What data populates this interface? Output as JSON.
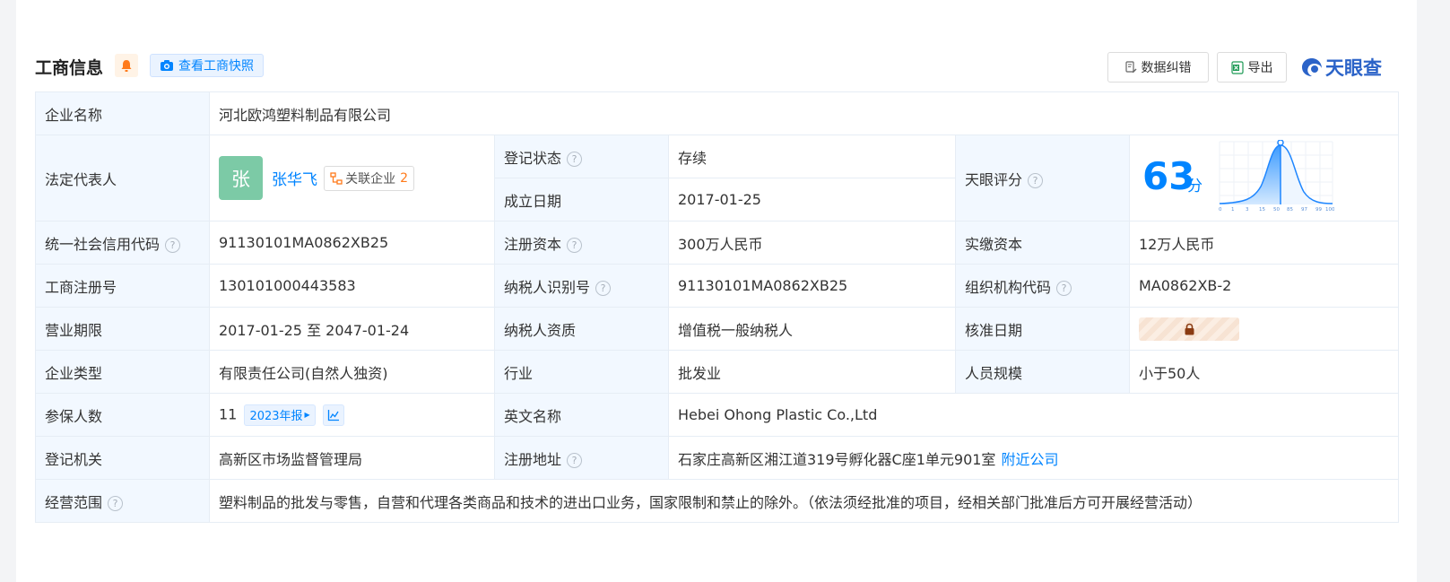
{
  "header": {
    "title": "工商信息",
    "snapshot_label": "查看工商快照",
    "correct_label": "数据纠错",
    "export_label": "导出",
    "logo_text": "天眼查",
    "accent_color": "#0084ff"
  },
  "rows": {
    "company_name": {
      "label": "企业名称",
      "value": "河北欧鸿塑料制品有限公司"
    },
    "legal_rep": {
      "label": "法定代表人",
      "avatar_char": "张",
      "name": "张华飞",
      "assoc_label": "关联企业",
      "assoc_count": "2"
    },
    "reg_status": {
      "label": "登记状态",
      "value": "存续"
    },
    "found_date": {
      "label": "成立日期",
      "value": "2017-01-25"
    },
    "score": {
      "label": "天眼评分",
      "value": "63",
      "unit": "分",
      "axis_ticks": [
        "0",
        "1",
        "3",
        "15",
        "50",
        "85",
        "97",
        "99",
        "100"
      ]
    },
    "credit_code": {
      "label": "统一社会信用代码",
      "value": "91130101MA0862XB25"
    },
    "reg_capital": {
      "label": "注册资本",
      "value": "300万人民币"
    },
    "paid_capital": {
      "label": "实缴资本",
      "value": "12万人民币"
    },
    "reg_no": {
      "label": "工商注册号",
      "value": "130101000443583"
    },
    "taxpayer_id": {
      "label": "纳税人识别号",
      "value": "91130101MA0862XB25"
    },
    "org_code": {
      "label": "组织机构代码",
      "value": "MA0862XB-2"
    },
    "business_term": {
      "label": "营业期限",
      "value": "2017-01-25 至 2047-01-24"
    },
    "taxpayer_qual": {
      "label": "纳税人资质",
      "value": "增值税一般纳税人"
    },
    "approval_date": {
      "label": "核准日期"
    },
    "company_type": {
      "label": "企业类型",
      "value": "有限责任公司(自然人独资)"
    },
    "industry": {
      "label": "行业",
      "value": "批发业"
    },
    "staff_size": {
      "label": "人员规模",
      "value": "小于50人"
    },
    "insured": {
      "label": "参保人数",
      "value": "11",
      "report_label": "2023年报"
    },
    "english_name": {
      "label": "英文名称",
      "value": "Hebei Ohong Plastic Co.,Ltd"
    },
    "reg_authority": {
      "label": "登记机关",
      "value": "高新区市场监督管理局"
    },
    "reg_address": {
      "label": "注册地址",
      "value": "石家庄高新区湘江道319号孵化器C座1单元901室",
      "nearby_label": "附近公司"
    },
    "business_scope": {
      "label": "经营范围",
      "value": "塑料制品的批发与零售，自营和代理各类商品和技术的进出口业务，国家限制和禁止的除外。（依法须经批准的项目，经相关部门批准后方可开展经营活动）"
    }
  }
}
